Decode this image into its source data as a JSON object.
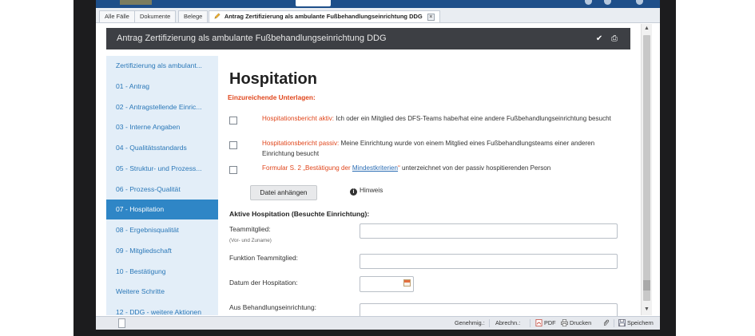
{
  "tabs": [
    {
      "label": "Alle Fälle"
    },
    {
      "label": "Dokumente"
    },
    {
      "label": "Belege"
    },
    {
      "label": "Antrag Zertifizierung als ambulante Fußbehandlungseinrichtung DDG",
      "active": true
    }
  ],
  "document": {
    "title": "Antrag Zertifizierung als ambulante Fußbehandlungseinrichtung DDG",
    "icons": [
      "check-icon",
      "print-icon"
    ]
  },
  "sidebar": {
    "items": [
      {
        "label": "Zertifizierung als ambulant..."
      },
      {
        "label": "01 - Antrag"
      },
      {
        "label": "02 - Antragstellende Einric..."
      },
      {
        "label": "03 - Interne Angaben"
      },
      {
        "label": "04 - Qualitätsstandards"
      },
      {
        "label": "05 - Struktur- und Prozess..."
      },
      {
        "label": "06 - Prozess-Qualität"
      },
      {
        "label": "07 - Hospitation",
        "active": true
      },
      {
        "label": "08 - Ergebnisqualität"
      },
      {
        "label": "09 - Mitgliedschaft"
      },
      {
        "label": "10 - Bestätigung"
      },
      {
        "label": "Weitere Schritte"
      },
      {
        "label": "12 - DDG - weitere Aktionen"
      }
    ]
  },
  "main": {
    "heading": "Hospitation",
    "warning": "Einzureichende Unterlagen:",
    "checks": [
      {
        "prefix": "Hospitationsbericht aktiv:",
        "text": " Ich oder ein Mitglied des DFS-Teams habe/hat eine andere Fußbehandlungseinrichtung besucht",
        "checked": false
      },
      {
        "prefix": "Hospitationsbericht passiv:",
        "text": " Meine Einrichtung wurde von einem Mitglied eines Fußbehandlungsteams einer anderen Einrichtung besucht",
        "checked": false
      },
      {
        "prefix": "Formular S. 2 „Bestätigung der ",
        "link": "Mindestkriterien",
        "suffix": "“",
        "text": " unterzeichnet von der passiv hospitierenden Person",
        "checked": false
      }
    ],
    "attach_button": "Datei anhängen",
    "hint": "Hinweis",
    "section_title": "Aktive Hospitation (Besuchte Einrichtung):",
    "fields": {
      "member_label": "Teammitglied:",
      "member_sub": "(Vor- und Zuname)",
      "member_value": "",
      "function_label": "Funktion Teammitglied:",
      "function_value": "",
      "date_label": "Datum der Hospitation:",
      "date_value": "",
      "from_label": "Aus Behandlungseinrichtung:",
      "from_value": ""
    }
  },
  "statusbar": {
    "approve": "Genehmig.:",
    "billing": "Abrechn.:",
    "pdf": "PDF",
    "print": "Drucken",
    "save": "Speichern"
  },
  "colors": {
    "header_blue": "#1e4f8a",
    "sidebar_bg": "#e3eef8",
    "sidebar_active": "#2f86c6",
    "title_bar": "#3d3f44",
    "warning_orange": "#e0461c",
    "link_blue": "#2b78b8"
  }
}
